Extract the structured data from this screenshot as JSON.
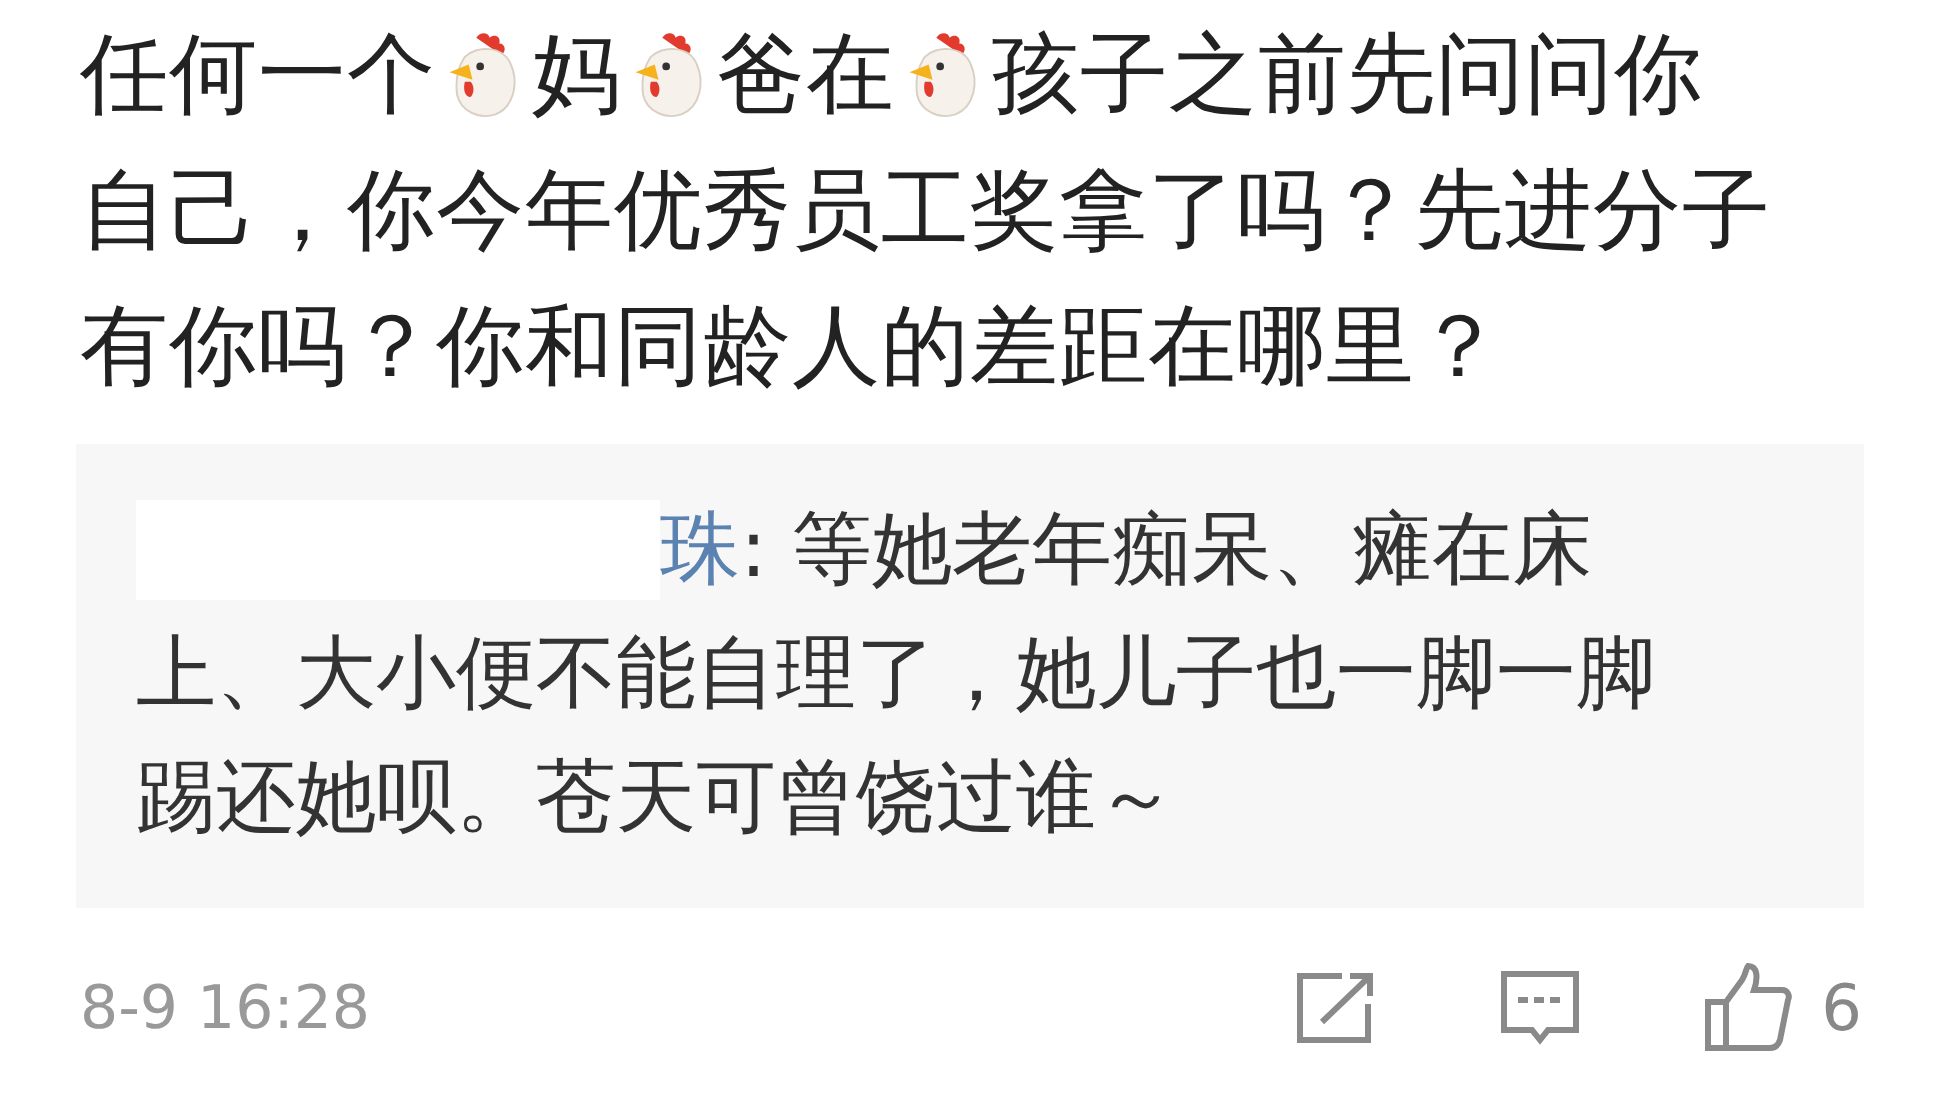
{
  "comment": {
    "lines": [
      [
        {
          "kind": "text",
          "text": "任何一个"
        },
        {
          "kind": "emoji"
        },
        {
          "kind": "text",
          "text": "妈"
        },
        {
          "kind": "emoji"
        },
        {
          "kind": "text",
          "text": "爸在"
        },
        {
          "kind": "emoji"
        },
        {
          "kind": "text",
          "text": "孩子之前先问问你"
        }
      ],
      [
        {
          "kind": "text",
          "text": "自己，你今年优秀员工奖拿了吗？先进分子"
        }
      ],
      [
        {
          "kind": "text",
          "text": "有你吗？你和同龄人的差距在哪里？"
        }
      ]
    ]
  },
  "quote": {
    "author": "珠",
    "first_line": ": 等她老年痴呆、瘫在床",
    "lines": [
      "上、大小便不能自理了，她儿子也一脚一脚",
      "踢还她呗。苍天可曾饶过谁～"
    ]
  },
  "footer": {
    "time": "8-9 16:28",
    "likes": "6"
  }
}
